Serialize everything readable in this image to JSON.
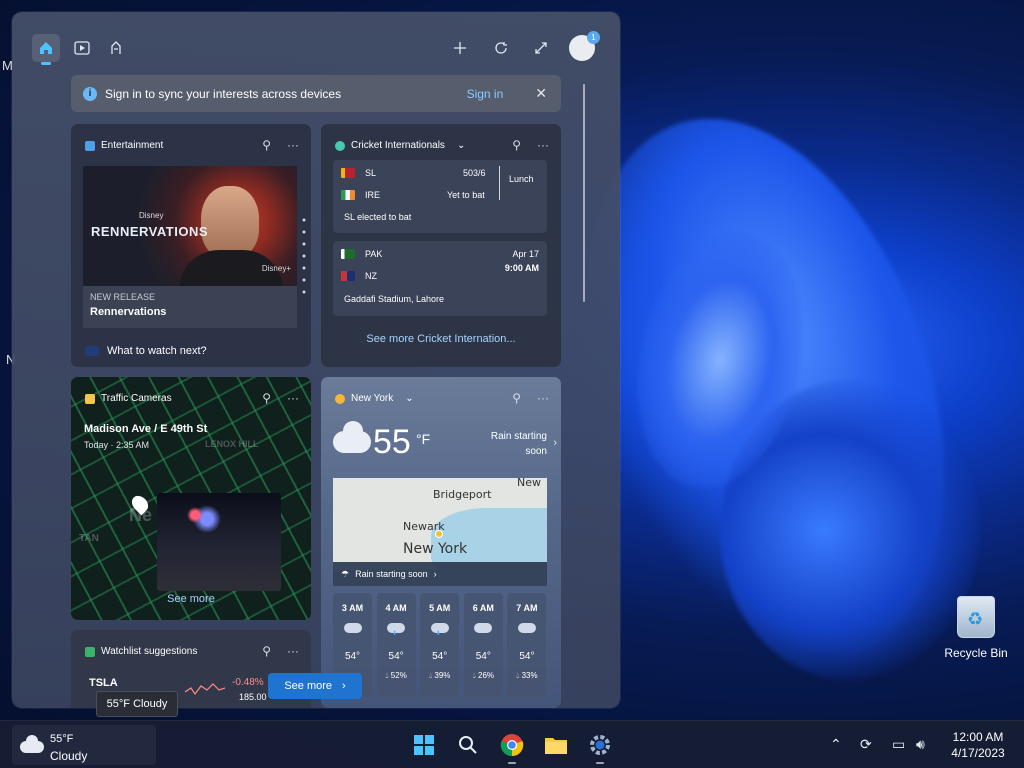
{
  "desktop": {
    "edge_letters": [
      "M",
      "N"
    ],
    "recycle_bin_label": "Recycle Bin"
  },
  "widgets": {
    "toolbar": {
      "home_icon": "home-icon",
      "video_icon": "video-icon",
      "games_icon": "games-icon",
      "add_icon": "plus-icon",
      "refresh_icon": "refresh-icon",
      "expand_icon": "expand-icon",
      "avatar_badge": "1"
    },
    "signin_bar": {
      "message": "Sign in to sync your interests across devices",
      "link": "Sign in"
    },
    "entertainment": {
      "title": "Entertainment",
      "poster_brand": "RENNERVATIONS",
      "poster_studio": "Disney",
      "poster_network": "Disney+",
      "kicker": "NEW RELEASE",
      "headline": "Rennervations",
      "prompt": "What to watch next?"
    },
    "cricket": {
      "title": "Cricket Internationals",
      "match1": {
        "team1": "SL",
        "team1_score": "503/6",
        "team2": "IRE",
        "team2_status": "Yet to bat",
        "state": "Lunch",
        "note": "SL elected to bat"
      },
      "match2": {
        "team1": "PAK",
        "team2": "NZ",
        "date": "Apr 17",
        "time": "9:00 AM",
        "venue": "Gaddafi Stadium, Lahore"
      },
      "more": "See more Cricket Internation..."
    },
    "traffic": {
      "title": "Traffic Cameras",
      "location": "Madison Ave / E 49th St",
      "time": "Today · 2:35 AM",
      "map_labels": [
        "LENOX HILL",
        "TAN",
        "Ne"
      ],
      "more": "See more"
    },
    "weather": {
      "title": "New York",
      "temp": "55",
      "unit": "°F",
      "rain_line1": "Rain starting",
      "rain_line2": "soon",
      "map": {
        "labels": [
          "Bridgeport",
          "New",
          "Newark",
          "New York"
        ],
        "banner": "Rain starting soon"
      },
      "hourly": [
        {
          "hour": "3 AM",
          "temp": "54°",
          "precip": "",
          "rainy": false
        },
        {
          "hour": "4 AM",
          "temp": "54°",
          "precip": "52%",
          "rainy": true
        },
        {
          "hour": "5 AM",
          "temp": "54°",
          "precip": "39%",
          "rainy": true
        },
        {
          "hour": "6 AM",
          "temp": "54°",
          "precip": "26%",
          "rainy": false
        },
        {
          "hour": "7 AM",
          "temp": "54°",
          "precip": "33%",
          "rainy": false
        }
      ]
    },
    "watchlist": {
      "title": "Watchlist suggestions",
      "symbol": "TSLA",
      "change": "-0.48%",
      "price": "185.00"
    },
    "see_more_button": "See more",
    "tooltip": "55°F Cloudy"
  },
  "taskbar": {
    "weather_temp": "55°F",
    "weather_cond": "Cloudy",
    "apps": [
      "windows-start",
      "search",
      "chrome",
      "file-explorer",
      "settings"
    ],
    "time": "12:00 AM",
    "date": "4/17/2023"
  }
}
